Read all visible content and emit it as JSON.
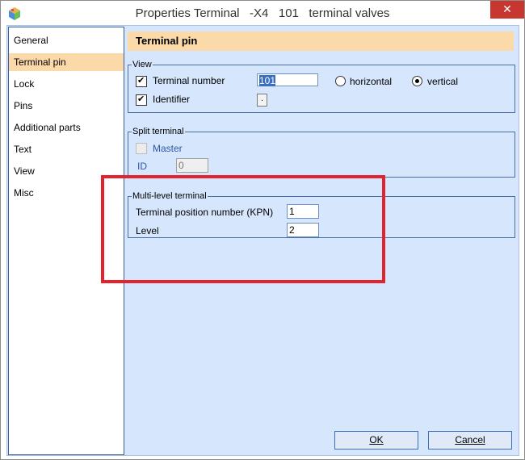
{
  "window": {
    "title": "Properties Terminal   -X4   101   terminal valves",
    "close_symbol": "✕"
  },
  "nav": {
    "items": [
      {
        "label": "General",
        "active": false
      },
      {
        "label": "Terminal pin",
        "active": true
      },
      {
        "label": "Lock",
        "active": false
      },
      {
        "label": "Pins",
        "active": false
      },
      {
        "label": "Additional parts",
        "active": false
      },
      {
        "label": "Text",
        "active": false
      },
      {
        "label": "View",
        "active": false
      },
      {
        "label": "Misc",
        "active": false
      }
    ]
  },
  "header": {
    "title": "Terminal pin"
  },
  "view_group": {
    "legend": "View",
    "terminal_number_label": "Terminal number",
    "terminal_number_checked": true,
    "terminal_number_value": "101",
    "horizontal_label": "horizontal",
    "vertical_label": "vertical",
    "orientation_selected": "vertical",
    "identifier_label": "Identifier",
    "identifier_checked": true,
    "identifier_button": "."
  },
  "split_group": {
    "legend": "Split terminal",
    "master_label": "Master",
    "master_checked": false,
    "id_label": "ID",
    "id_value": "0"
  },
  "multilevel_group": {
    "legend": "Multi-level terminal",
    "kpn_label": "Terminal position number (KPN)",
    "kpn_value": "1",
    "level_label": "Level",
    "level_value": "2"
  },
  "buttons": {
    "ok": "OK",
    "cancel": "Cancel"
  },
  "colors": {
    "highlight_box": "#e2232e",
    "header_bg": "#fbd9a8",
    "client_bg": "#d6e6fc"
  }
}
